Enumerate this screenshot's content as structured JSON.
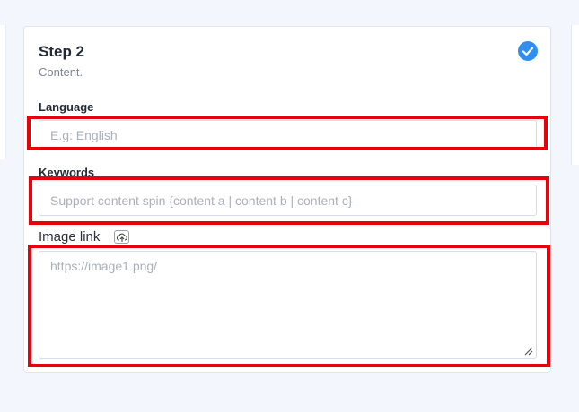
{
  "step": {
    "title": "Step 2",
    "subtitle": "Content.",
    "status_icon": "check-circle-icon",
    "accent_color": "#2f8ef0"
  },
  "fields": {
    "language": {
      "label": "Language",
      "placeholder": "E.g: English",
      "value": ""
    },
    "keywords": {
      "label": "Keywords",
      "placeholder": "Support content spin {content a | content b | content c}",
      "value": ""
    },
    "image_link": {
      "label": "Image link",
      "placeholder": "https://image1.png/",
      "value": "",
      "action_icon": "cloud-upload-icon"
    }
  },
  "highlight_color": "#e8000b"
}
